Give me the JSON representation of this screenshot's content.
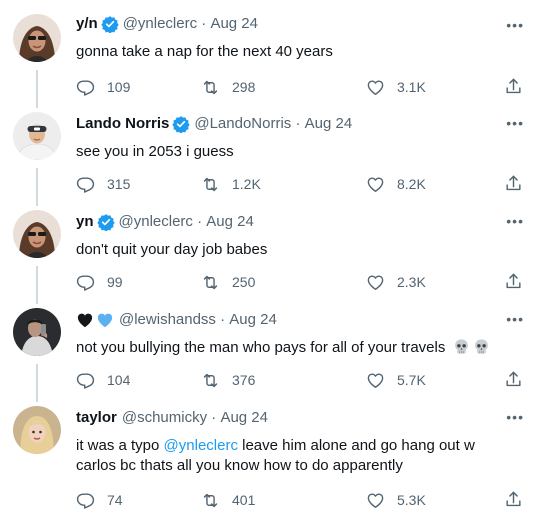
{
  "tweets": [
    {
      "name": "y/n",
      "verified": true,
      "handle": "@ynleclerc",
      "date": "Aug 24",
      "text": "gonna take a nap for the next 40 years",
      "replies": "109",
      "retweets": "298",
      "likes": "3.1K"
    },
    {
      "name": "Lando Norris",
      "verified": true,
      "handle": "@LandoNorris",
      "date": "Aug 24",
      "text": "see you in 2053 i guess",
      "replies": "315",
      "retweets": "1.2K",
      "likes": "8.2K"
    },
    {
      "name": "yn",
      "verified": true,
      "handle": "@ynleclerc",
      "date": "Aug 24",
      "text": "don't quit your day job babes",
      "replies": "99",
      "retweets": "250",
      "likes": "2.3K"
    },
    {
      "name": "",
      "name_emoji": [
        "black-heart",
        "blue-heart"
      ],
      "verified": false,
      "handle": "@lewishandss",
      "date": "Aug 24",
      "text": "not you bullying the man who pays for all of your travels",
      "text_emoji": [
        "skull",
        "skull"
      ],
      "replies": "104",
      "retweets": "376",
      "likes": "5.7K"
    },
    {
      "name": "taylor",
      "verified": false,
      "handle": "@schumicky",
      "date": "Aug 24",
      "text_pre": "it was a typo ",
      "text_mention": "@ynleclerc",
      "text_post": " leave him alone and go hang out w carlos bc thats all you know how to do apparently",
      "replies": "74",
      "retweets": "401",
      "likes": "5.3K"
    }
  ],
  "separator": "·",
  "colors": {
    "text": "#0f1419",
    "muted": "#536471",
    "accent": "#1d9bf0",
    "thread_line": "#cfd9de"
  }
}
